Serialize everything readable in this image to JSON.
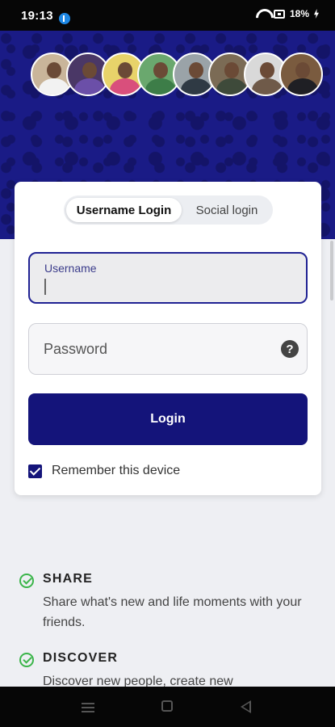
{
  "status_bar": {
    "time": "19:13",
    "battery": "18%",
    "icons": [
      "bluetooth-icon",
      "wifi-icon",
      "battery-saver-icon",
      "charging-icon"
    ]
  },
  "hero": {
    "background_color": "#1a1b86",
    "avatars": [
      {
        "name": "avatar-1",
        "bg": "#c9b59a",
        "shirt": "#f2f2f2"
      },
      {
        "name": "avatar-2",
        "bg": "#4a3766",
        "shirt": "#6b4fa8"
      },
      {
        "name": "avatar-3",
        "bg": "#e8d36a",
        "shirt": "#d94f7c"
      },
      {
        "name": "avatar-4",
        "bg": "#6aa86e",
        "shirt": "#3d7d48"
      },
      {
        "name": "avatar-5",
        "bg": "#9aa3a8",
        "shirt": "#2f3a44"
      },
      {
        "name": "avatar-6",
        "bg": "#7b6b55",
        "shirt": "#3e4a3a"
      },
      {
        "name": "avatar-7",
        "bg": "#d9d9d9",
        "shirt": "#6f5a49"
      },
      {
        "name": "avatar-8",
        "bg": "#7a5b3f",
        "shirt": "#1f1f24"
      }
    ]
  },
  "login_card": {
    "tabs": {
      "active": "Username Login",
      "inactive": "Social login"
    },
    "username": {
      "label": "Username",
      "value": ""
    },
    "password": {
      "placeholder": "Password",
      "help_icon": "?"
    },
    "login_button": "Login",
    "remember": {
      "label": "Remember this device",
      "checked": true
    }
  },
  "features": [
    {
      "title": "SHARE",
      "description": "Share what's new and life moments with your friends."
    },
    {
      "title": "DISCOVER",
      "description": "Discover new people, create new"
    }
  ],
  "colors": {
    "primary": "#14147a",
    "accent_check": "#3bb54a"
  }
}
